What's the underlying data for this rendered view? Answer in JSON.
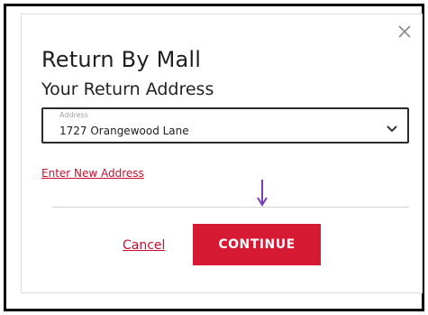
{
  "dialog": {
    "title": "Return By Mall",
    "subtitle": "Your Return Address",
    "close_icon": "close-icon"
  },
  "address_select": {
    "caption": "Address",
    "value": "1727 Orangewood Lane",
    "icon": "chevron-down-icon"
  },
  "links": {
    "enter_new_address": "Enter New Address",
    "cancel": "Cancel"
  },
  "buttons": {
    "continue": "CONTINUE"
  },
  "annotation": {
    "icon": "arrow-down-icon",
    "color": "#7a3fb8"
  },
  "colors": {
    "accent": "#d71a34",
    "link": "#c8102e"
  }
}
